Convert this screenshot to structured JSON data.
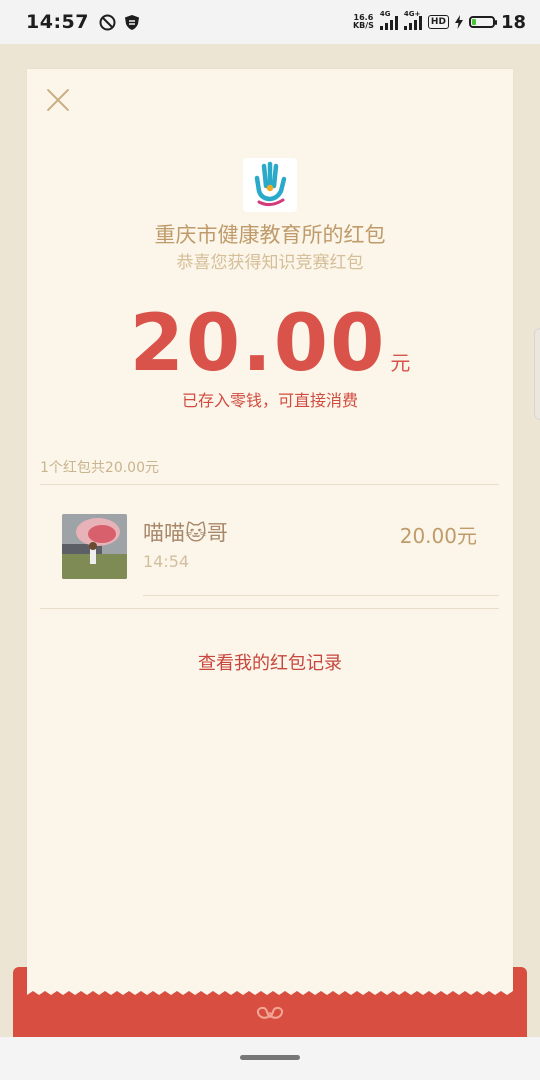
{
  "status_bar": {
    "time": "14:57",
    "net_speed_value": "16.6",
    "net_speed_unit": "KB/S",
    "sim1_tag": "4G",
    "sim2_tag": "4G+",
    "hd_label": "HD",
    "battery_percent": "18"
  },
  "card": {
    "sender_title": "重庆市健康教育所的红包",
    "sender_subtitle": "恭喜您获得知识竞赛红包",
    "amount": "20.00",
    "currency": "元",
    "stored_note": "已存入零钱，可直接消费",
    "summary": "1个红包共20.00元",
    "receiver": {
      "name": "喵喵🐱哥",
      "time": "14:54",
      "amount": "20.00元"
    },
    "history_link": "查看我的红包记录"
  },
  "colors": {
    "amount_red": "#d9534a",
    "envelope_red": "#d84f41",
    "card_bg": "#fbf6e9",
    "gold_text": "#bf9b6b"
  }
}
